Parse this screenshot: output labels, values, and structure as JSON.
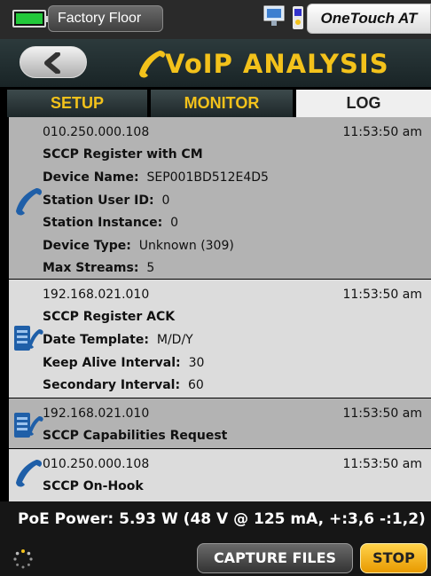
{
  "status_bar": {
    "location": "Factory Floor",
    "device_name": "OneTouch AT",
    "battery_color": "#22c83a"
  },
  "title_bar": {
    "title": "VoIP ANALYSIS",
    "back_icon": "chevron-left-icon",
    "title_icon": "phone-handset-icon",
    "accent_color": "#f3c21b"
  },
  "tabs": [
    {
      "label": "SETUP",
      "active": false
    },
    {
      "label": "MONITOR",
      "active": false
    },
    {
      "label": "LOG",
      "active": true
    }
  ],
  "log": [
    {
      "icon": "phone-handset-icon",
      "address": "010.250.000.108",
      "time": "11:53:50 am",
      "message": "SCCP Register with CM",
      "fields": [
        {
          "label": "Device Name:",
          "value": "SEP001BD512E4D5"
        },
        {
          "label": "Station User ID:",
          "value": "0"
        },
        {
          "label": "Station Instance:",
          "value": "0"
        },
        {
          "label": "Device Type:",
          "value": "Unknown (309)"
        },
        {
          "label": "Max Streams:",
          "value": "5"
        }
      ]
    },
    {
      "icon": "call-manager-server-icon",
      "address": "192.168.021.010",
      "time": "11:53:50 am",
      "message": "SCCP Register ACK",
      "fields": [
        {
          "label": "Date Template:",
          "value": "M/D/Y"
        },
        {
          "label": "Keep Alive Interval:",
          "value": "30"
        },
        {
          "label": "Secondary Interval:",
          "value": "60"
        }
      ]
    },
    {
      "icon": "call-manager-server-icon",
      "address": "192.168.021.010",
      "time": "11:53:50 am",
      "message": "SCCP Capabilities Request",
      "fields": []
    },
    {
      "icon": "phone-handset-icon",
      "address": "010.250.000.108",
      "time": "11:53:50 am",
      "message": "SCCP On-Hook",
      "fields": []
    }
  ],
  "footer": {
    "poe_power": "PoE Power: 5.93 W (48 V @ 125 mA, +:3,6 -:1,2)",
    "capture_label": "CAPTURE FILES",
    "stop_label": "STOP"
  }
}
